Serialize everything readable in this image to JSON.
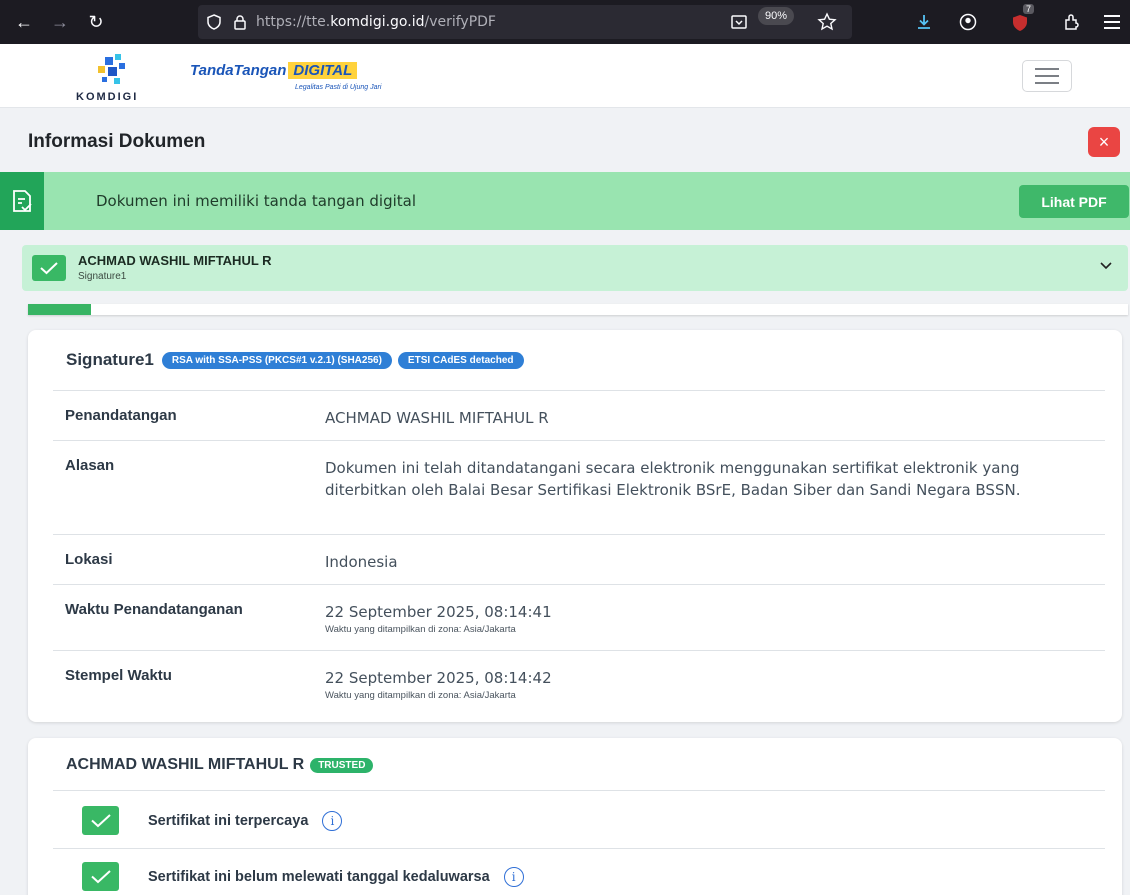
{
  "browser": {
    "url_prefix": "https://tte.",
    "url_domain": "komdigi.go.id",
    "url_path": "/verifyPDF",
    "zoom": "90%",
    "extension_badge": "7"
  },
  "header": {
    "brand": "KOMDIGI",
    "tte_tanda": "TandaTangan",
    "tte_digital": "DIGITAL",
    "tte_tagline": "Legalitas Pasti di Ujung Jari"
  },
  "document": {
    "title": "Informasi Dokumen",
    "close_label": "×",
    "banner_text": "Dokumen ini memiliki tanda tangan digital",
    "view_pdf_label": "Lihat PDF"
  },
  "signer": {
    "name": "ACHMAD WASHIL MIFTAHUL R",
    "signature_id": "Signature1"
  },
  "progress": {
    "fraction": 0.057
  },
  "signature": {
    "title": "Signature1",
    "algorithm": "RSA with SSA-PSS (PKCS#1 v.2.1) (SHA256)",
    "format": "ETSI CAdES detached",
    "rows": [
      {
        "label": "Penandatangan",
        "value": "ACHMAD WASHIL MIFTAHUL R",
        "note": ""
      },
      {
        "label": "Alasan",
        "value": "Dokumen ini telah ditandatangani secara elektronik menggunakan sertifikat elektronik yang diterbitkan oleh Balai Besar Sertifikasi Elektronik BSrE, Badan Siber dan Sandi Negara BSSN.",
        "note": ""
      },
      {
        "label": "Lokasi",
        "value": "Indonesia",
        "note": ""
      },
      {
        "label": "Waktu Penandatanganan",
        "value": "22 September 2025, 08:14:41",
        "note": "Waktu yang ditampilkan di zona: Asia/Jakarta"
      },
      {
        "label": "Stempel Waktu",
        "value": "22 September 2025, 08:14:42",
        "note": "Waktu yang ditampilkan di zona: Asia/Jakarta"
      }
    ]
  },
  "certificate": {
    "owner": "ACHMAD WASHIL MIFTAHUL R",
    "status_badge": "TRUSTED",
    "checks": [
      {
        "label": "Sertifikat ini terpercaya"
      },
      {
        "label": "Sertifikat ini belum melewati tanggal kedaluwarsa"
      }
    ]
  },
  "colors": {
    "banner_green": "#99e4b0",
    "signer_green": "#c6f1d6",
    "check_green": "#39b865",
    "close_red": "#ea4543",
    "pill_blue": "#2f7fd6"
  }
}
